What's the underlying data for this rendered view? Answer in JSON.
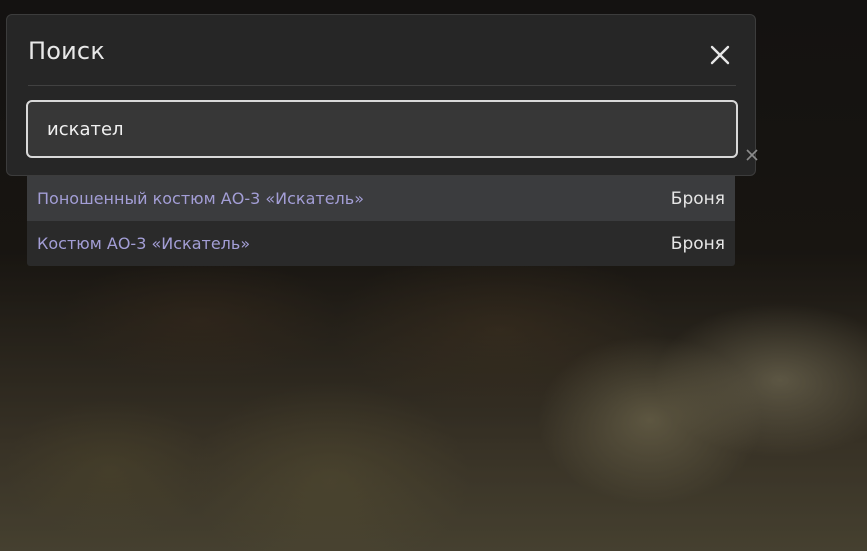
{
  "search_dialog": {
    "title": "Поиск",
    "query": "искател",
    "close_icon": "close-icon",
    "clear_icon": "clear-icon"
  },
  "results": [
    {
      "name": "Поношенный костюм АО-3 «Искатель»",
      "category": "Броня",
      "highlighted": true
    },
    {
      "name": "Костюм АО-3 «Искатель»",
      "category": "Броня",
      "highlighted": false
    }
  ],
  "colors": {
    "panel_bg": "#262626",
    "input_bg": "#373737",
    "result_link": "#a39ed6",
    "result_hover_bg": "#3b3c3e"
  }
}
